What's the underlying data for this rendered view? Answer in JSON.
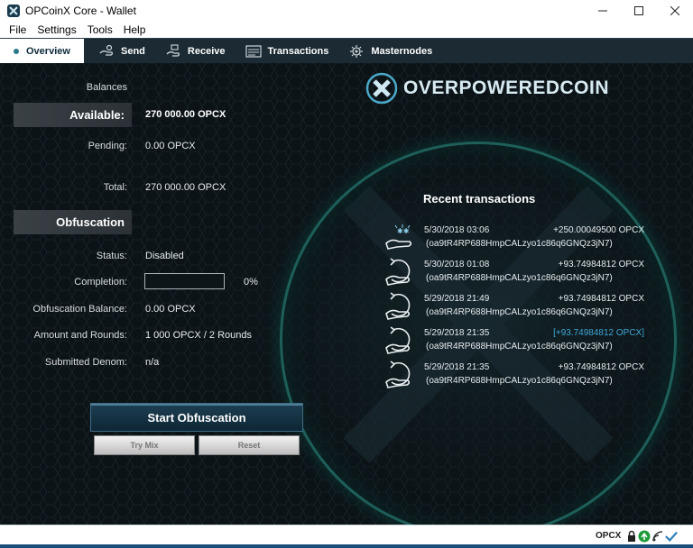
{
  "window": {
    "title": "OPCoinX Core - Wallet"
  },
  "menu": [
    "File",
    "Settings",
    "Tools",
    "Help"
  ],
  "tabs": [
    {
      "label": "Overview",
      "icon": "overview-dot-icon",
      "active": true
    },
    {
      "label": "Send",
      "icon": "send-icon"
    },
    {
      "label": "Receive",
      "icon": "receive-icon"
    },
    {
      "label": "Transactions",
      "icon": "transactions-icon"
    },
    {
      "label": "Masternodes",
      "icon": "masternodes-icon"
    }
  ],
  "overview": {
    "balances_label": "Balances",
    "available_label": "Available:",
    "available_value": "270 000.00 OPCX",
    "pending_label": "Pending:",
    "pending_value": "0.00 OPCX",
    "total_label": "Total:",
    "total_value": "270 000.00 OPCX"
  },
  "obfuscation": {
    "header": "Obfuscation",
    "status_label": "Status:",
    "status_value": "Disabled",
    "completion_label": "Completion:",
    "completion_percent": "0%",
    "completion_fraction": 0,
    "balance_label": "Obfuscation Balance:",
    "balance_value": "0.00 OPCX",
    "rounds_label": "Amount and Rounds:",
    "rounds_value": "1 000 OPCX / 2 Rounds",
    "denom_label": "Submitted Denom:",
    "denom_value": "n/a",
    "start_button": "Start Obfuscation",
    "try_mix_button": "Try Mix",
    "reset_button": "Reset"
  },
  "brand": {
    "logo_text": "OVERPOWEREDCOIN"
  },
  "recent": {
    "title": "Recent transactions",
    "items": [
      {
        "date": "5/30/2018 03:06",
        "amount": "+250.00049500 OPCX",
        "address": "(oa9tR4RP688HmpCALzyo1c86q6GNQz3jN7)",
        "icon": "mined-hand-icon",
        "highlight": false
      },
      {
        "date": "5/30/2018 01:08",
        "amount": "+93.74984812 OPCX",
        "address": "(oa9tR4RP688HmpCALzyo1c86q6GNQz3jN7)",
        "icon": "receive-hand-icon",
        "highlight": false
      },
      {
        "date": "5/29/2018 21:49",
        "amount": "+93.74984812 OPCX",
        "address": "(oa9tR4RP688HmpCALzyo1c86q6GNQz3jN7)",
        "icon": "receive-hand-icon",
        "highlight": false
      },
      {
        "date": "5/29/2018 21:35",
        "amount": "[+93.74984812 OPCX]",
        "address": "(oa9tR4RP688HmpCALzyo1c86q6GNQz3jN7)",
        "icon": "receive-hand-icon",
        "highlight": true
      },
      {
        "date": "5/29/2018 21:35",
        "amount": "+93.74984812 OPCX",
        "address": "(oa9tR4RP688HmpCALzyo1c86q6GNQz3jN7)",
        "icon": "receive-hand-icon",
        "highlight": false
      }
    ]
  },
  "statusbar": {
    "unit": "OPCX"
  },
  "colors": {
    "accent": "#0f2a3c",
    "highlight_amount": "#3ea7d8",
    "ring": "#1e5f5a"
  }
}
